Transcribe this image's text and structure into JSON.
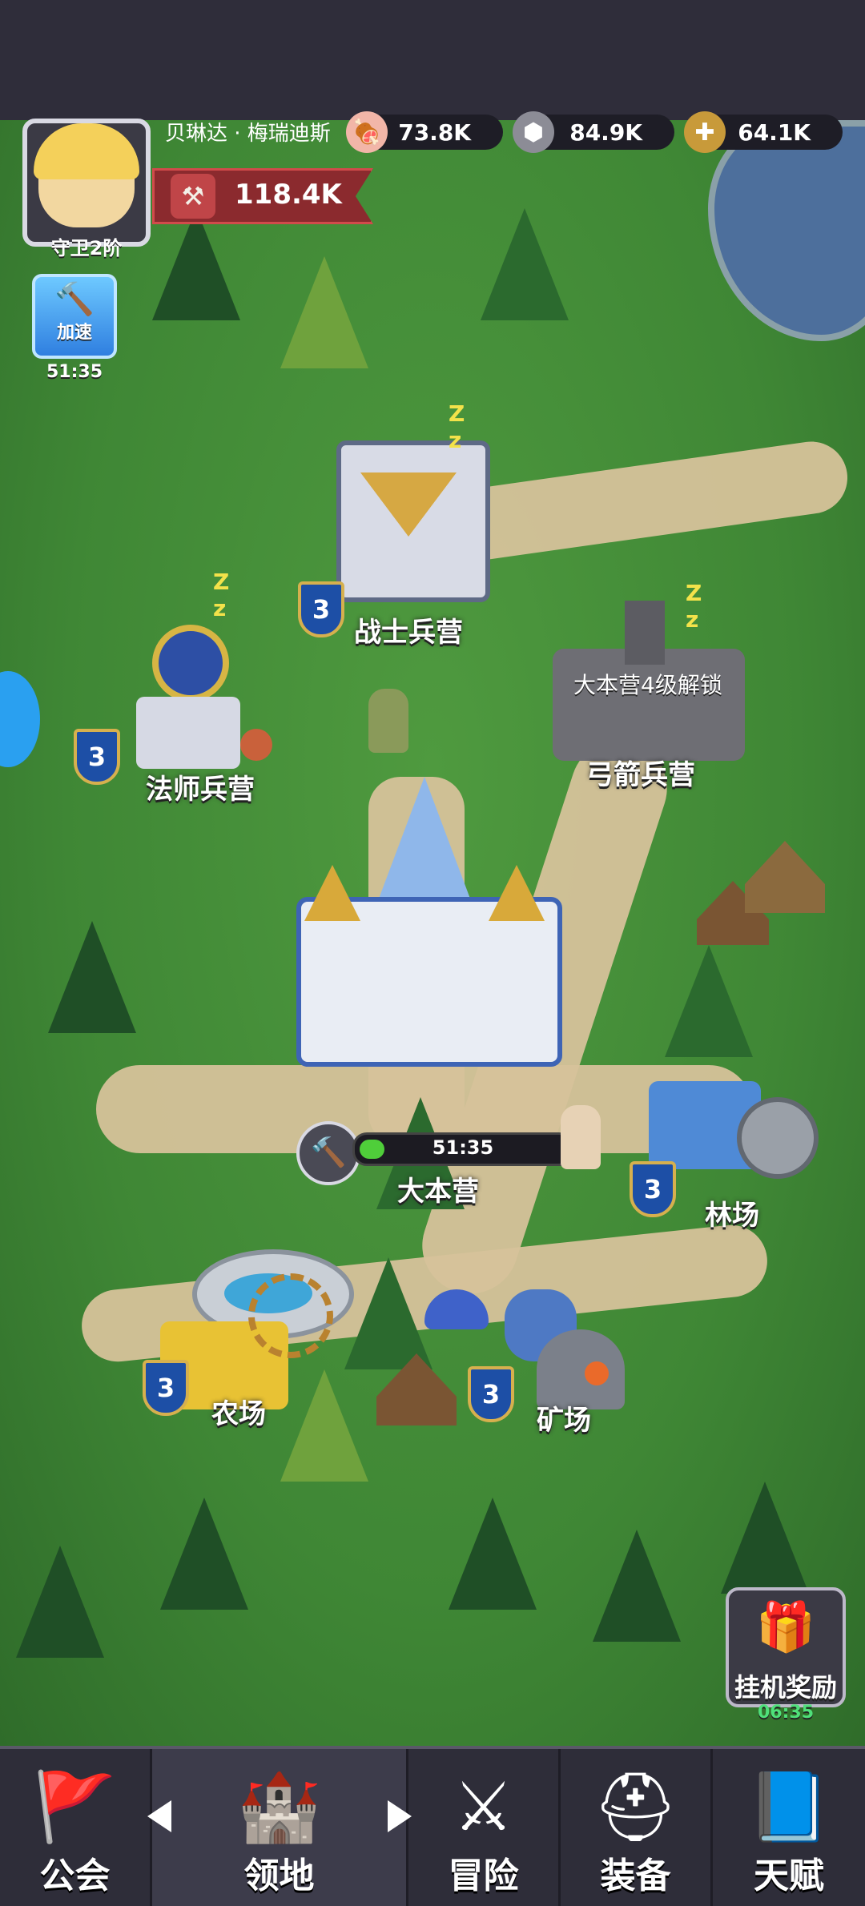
{
  "player": {
    "name": "贝琳达 · 梅瑞迪斯",
    "rank": "守卫2阶",
    "power": "118.4K"
  },
  "resources": [
    {
      "name": "meat",
      "icon": "meat-icon",
      "value": "73.8K"
    },
    {
      "name": "stone",
      "icon": "stone-icon",
      "value": "84.9K"
    },
    {
      "name": "wood",
      "icon": "wood-icon",
      "value": "64.1K"
    }
  ],
  "speedup": {
    "label": "加速",
    "timer": "51:35"
  },
  "buildings": {
    "warrior": {
      "name": "战士兵营",
      "level": "3"
    },
    "mage": {
      "name": "法师兵营",
      "level": "3"
    },
    "archer": {
      "name": "弓箭兵营",
      "lock_text": "大本营4级解锁"
    },
    "main": {
      "name": "大本营",
      "timer": "51:35",
      "progress": 0.12
    },
    "lumber": {
      "name": "林场",
      "level": "3"
    },
    "farm": {
      "name": "农场",
      "level": "3"
    },
    "mine": {
      "name": "矿场",
      "level": "3"
    }
  },
  "idle_reward": {
    "label": "挂机奖励",
    "timer": "06:35"
  },
  "nav": [
    {
      "label": "公会",
      "icon": "guild-banner-icon"
    },
    {
      "label": "领地",
      "icon": "castle-icon"
    },
    {
      "label": "冒险",
      "icon": "crossed-axes-icon"
    },
    {
      "label": "装备",
      "icon": "helmet-icon"
    },
    {
      "label": "天赋",
      "icon": "talent-book-icon"
    }
  ]
}
